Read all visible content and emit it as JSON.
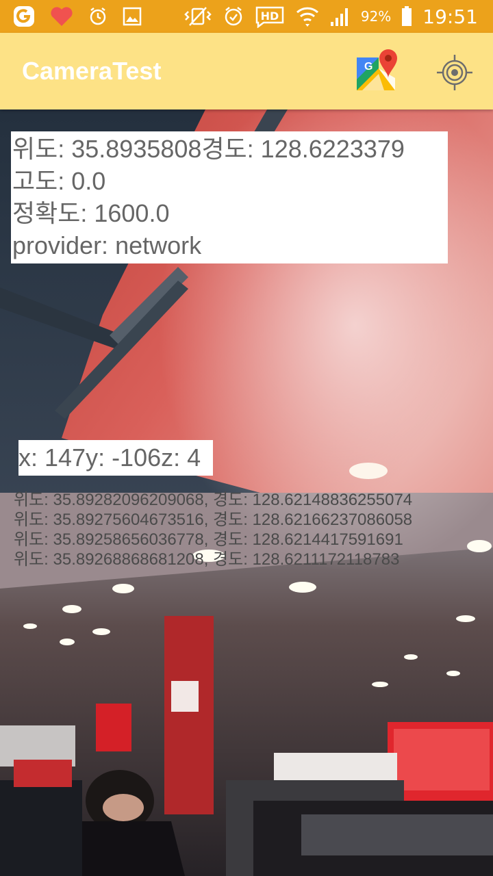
{
  "status_bar": {
    "battery_percent": "92%",
    "time": "19:51",
    "icons": [
      "notification-app-icon",
      "heart-icon",
      "alarm-icon",
      "gallery-icon",
      "vibrate-icon",
      "alarm-clock-icon",
      "hd-voice-icon",
      "wifi-icon",
      "signal-icon",
      "battery-icon"
    ],
    "color": "#eca21b"
  },
  "app_bar": {
    "title": "CameraTest",
    "actions": [
      "google-maps-icon",
      "gps-location-icon"
    ],
    "color": "#fde286"
  },
  "location": {
    "line1": "위도: 35.8935808경도: 128.6223379",
    "line2": "고도: 0.0",
    "line3": "정확도: 1600.0",
    "line4": "provider: network"
  },
  "sensor": {
    "text": "x: 147y: -106z: 4"
  },
  "history": [
    "위도: 35.89282096209068, 경도: 128.62148836255074",
    "위도: 35.89275604673516, 경도: 128.62166237086058",
    "위도: 35.89258656036778, 경도: 128.6214417591691",
    "위도: 35.89268868681208, 경도: 128.6211172118783"
  ]
}
